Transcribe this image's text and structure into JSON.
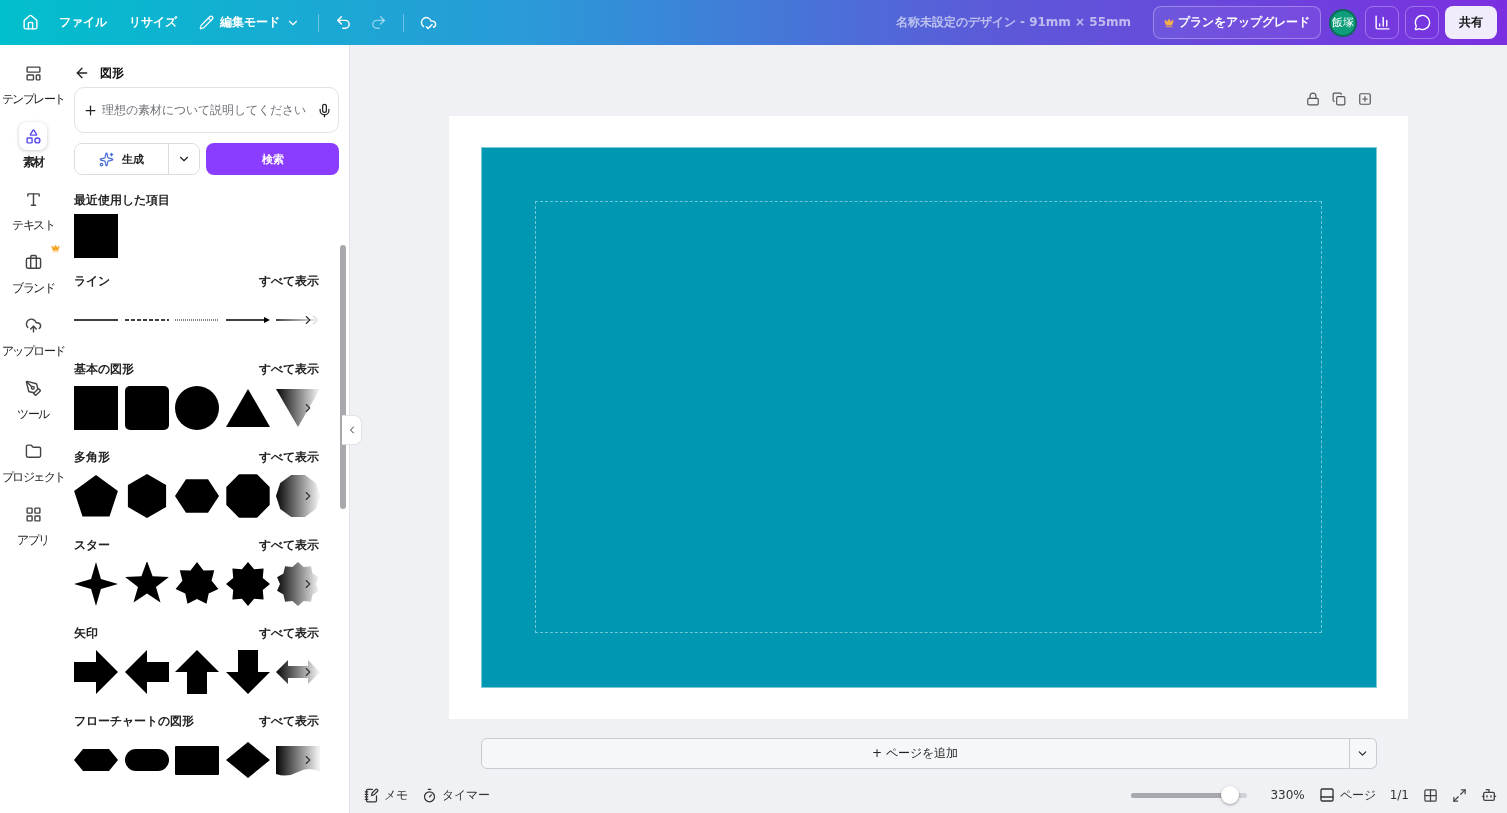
{
  "topbar": {
    "menu": [
      {
        "label": "ファイル"
      },
      {
        "label": "リサイズ"
      }
    ],
    "edit_mode": "編集モード",
    "title": "名称未設定のデザイン - 91mm × 55mm",
    "upgrade": "プランをアップグレード",
    "avatar": "飯塚",
    "share": "共有"
  },
  "sidebar": {
    "items": [
      {
        "label": "テンプレート",
        "selected": false,
        "premium": false
      },
      {
        "label": "素材",
        "selected": true,
        "premium": false
      },
      {
        "label": "テキスト",
        "selected": false,
        "premium": false
      },
      {
        "label": "ブランド",
        "selected": false,
        "premium": true
      },
      {
        "label": "アップロード",
        "selected": false,
        "premium": false
      },
      {
        "label": "ツール",
        "selected": false,
        "premium": false
      },
      {
        "label": "プロジェクト",
        "selected": false,
        "premium": false
      },
      {
        "label": "アプリ",
        "selected": false,
        "premium": false
      }
    ]
  },
  "panel": {
    "title": "図形",
    "prompt": {
      "placeholder": "理想の素材について説明してください"
    },
    "generate": "生成",
    "search": "検索",
    "recent": {
      "title": "最近使用した項目"
    },
    "sections": [
      {
        "title": "ライン",
        "see_all": "すべて表示",
        "items": [
          {
            "kind": "line-solid"
          },
          {
            "kind": "line-dashed"
          },
          {
            "kind": "line-dotted"
          },
          {
            "kind": "line-arrow"
          },
          {
            "kind": "line-open-arrow"
          }
        ]
      },
      {
        "title": "基本の図形",
        "see_all": "すべて表示",
        "items": [
          {
            "kind": "square"
          },
          {
            "kind": "rounded-square"
          },
          {
            "kind": "circle"
          },
          {
            "kind": "triangle"
          },
          {
            "kind": "inverted-triangle"
          }
        ]
      },
      {
        "title": "多角形",
        "see_all": "すべて表示",
        "items": [
          {
            "kind": "pentagon"
          },
          {
            "kind": "hexagon"
          },
          {
            "kind": "hexagon-flat"
          },
          {
            "kind": "octagon"
          },
          {
            "kind": "decagon"
          }
        ]
      },
      {
        "title": "スター",
        "see_all": "すべて表示",
        "items": [
          {
            "kind": "star-4"
          },
          {
            "kind": "star-5"
          },
          {
            "kind": "star-7"
          },
          {
            "kind": "star-8"
          },
          {
            "kind": "star-10"
          }
        ]
      },
      {
        "title": "矢印",
        "see_all": "すべて表示",
        "items": [
          {
            "kind": "arrow-right"
          },
          {
            "kind": "arrow-left"
          },
          {
            "kind": "arrow-up"
          },
          {
            "kind": "arrow-down"
          },
          {
            "kind": "arrow-both"
          }
        ]
      },
      {
        "title": "フローチャートの図形",
        "see_all": "すべて表示",
        "items": [
          {
            "kind": "flow-hexagon"
          },
          {
            "kind": "flow-pill"
          },
          {
            "kind": "flow-rect"
          },
          {
            "kind": "flow-diamond"
          },
          {
            "kind": "flow-document"
          }
        ]
      }
    ]
  },
  "canvas": {
    "add_page": "+ ページを追加"
  },
  "footer": {
    "notes": "メモ",
    "timer": "タイマー",
    "zoom": {
      "level": 0.85,
      "reading": "330%"
    },
    "pages": "ページ",
    "page_count": "1/1"
  }
}
